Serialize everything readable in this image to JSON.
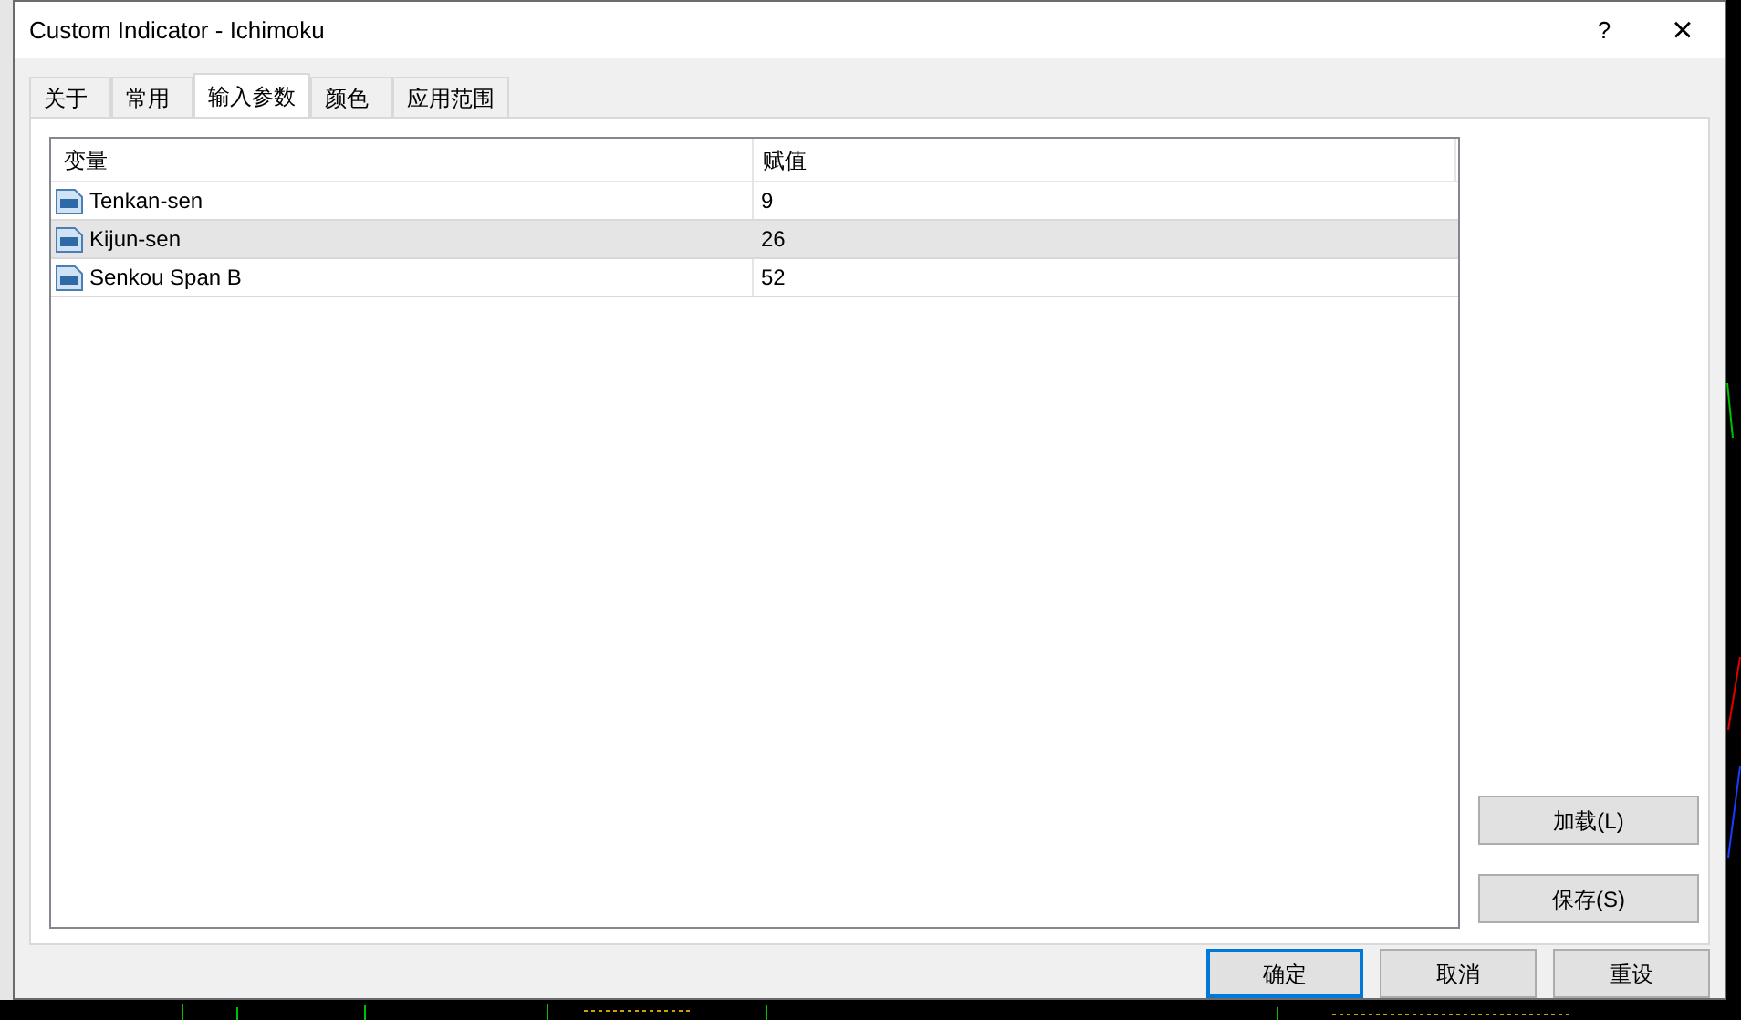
{
  "window": {
    "title": "Custom Indicator - Ichimoku",
    "help": "?",
    "close": "×"
  },
  "tabs": [
    {
      "label": "关于",
      "selected": false
    },
    {
      "label": "常用",
      "selected": false
    },
    {
      "label": "输入参数",
      "selected": true
    },
    {
      "label": "颜色",
      "selected": false
    },
    {
      "label": "应用范围",
      "selected": false
    }
  ],
  "table": {
    "columns": [
      "变量",
      "赋值"
    ],
    "rows": [
      {
        "name": "Tenkan-sen",
        "value": "9",
        "selected": false
      },
      {
        "name": "Kijun-sen",
        "value": "26",
        "selected": true
      },
      {
        "name": "Senkou Span B",
        "value": "52",
        "selected": false
      }
    ]
  },
  "side_buttons": [
    "加载(L)",
    "保存(S)"
  ],
  "buttons": [
    {
      "label": "确定",
      "default": true
    },
    {
      "label": "取消",
      "default": false
    },
    {
      "label": "重设",
      "default": false
    }
  ]
}
